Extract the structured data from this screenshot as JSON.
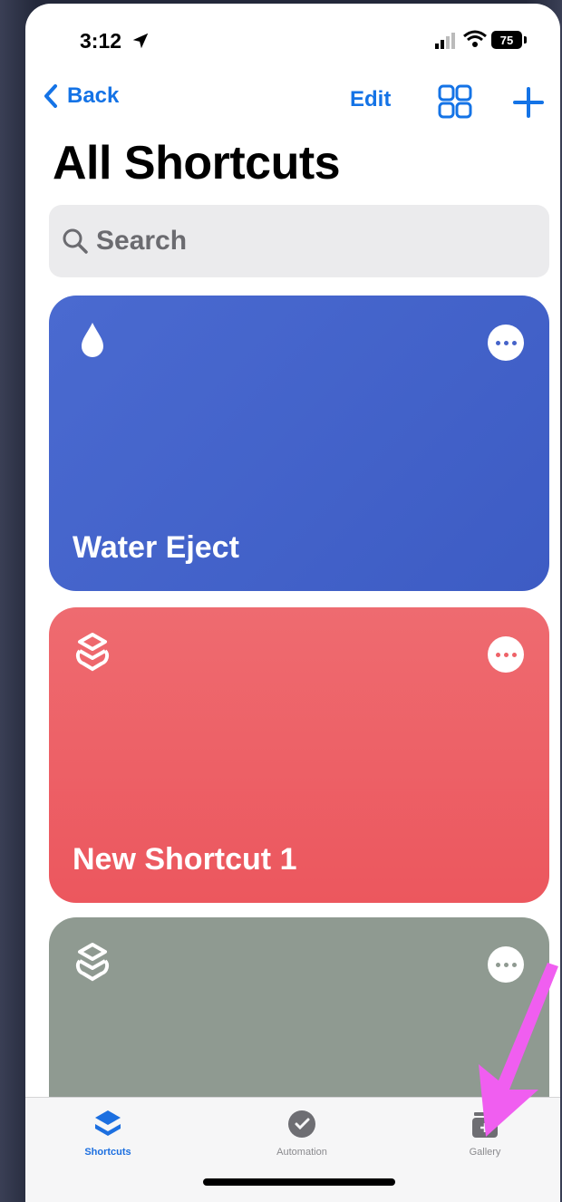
{
  "status_bar": {
    "time": "3:12",
    "battery": "75"
  },
  "nav": {
    "back_label": "Back",
    "edit_label": "Edit"
  },
  "page_title": "All Shortcuts",
  "search": {
    "placeholder": "Search"
  },
  "shortcuts": [
    {
      "name": "Water Eject",
      "color": "#4563c9",
      "icon": "drop-icon"
    },
    {
      "name": "New Shortcut 1",
      "color": "#ee6268",
      "icon": "shortcuts-layers-icon"
    },
    {
      "name": "",
      "color": "#8f9a91",
      "icon": "shortcuts-layers-icon"
    }
  ],
  "tabbar": {
    "tabs": [
      {
        "label": "Shortcuts",
        "active": true
      },
      {
        "label": "Automation",
        "active": false
      },
      {
        "label": "Gallery",
        "active": false
      }
    ]
  },
  "colors": {
    "accent": "#1473e6",
    "annotation_arrow": "#f05ef0"
  }
}
